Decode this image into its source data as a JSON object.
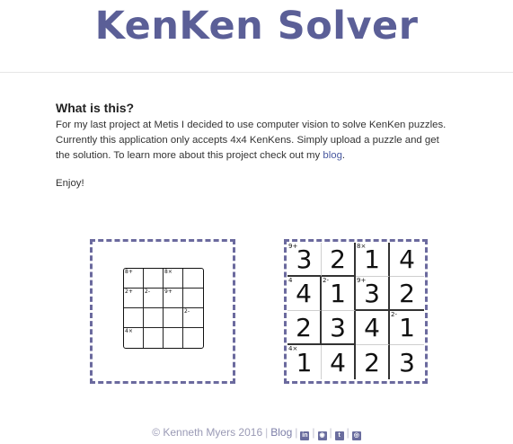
{
  "header": {
    "title": "KenKen Solver"
  },
  "intro": {
    "heading": "What is this?",
    "line1": "For my last project at Metis I decided to use computer vision to solve KenKen puzzles.",
    "line2": "Currently this application only accepts 4x4 KenKens. Simply upload a puzzle and get",
    "line3_before": "the solution. To learn more about this project check out my ",
    "blog_link": "blog",
    "line3_after": ".",
    "enjoy": "Enjoy!"
  },
  "upload_puzzle": {
    "clues": {
      "0": "8+",
      "2": "8×",
      "4": "2+",
      "5": "2-",
      "6": "9+",
      "11": "2-",
      "12": "4×"
    }
  },
  "solution": {
    "values": [
      "3",
      "2",
      "1",
      "4",
      "4",
      "1",
      "3",
      "2",
      "2",
      "3",
      "4",
      "1",
      "1",
      "4",
      "2",
      "3"
    ],
    "clues": {
      "0": "9+",
      "2": "8×",
      "4": "4",
      "5": "2-",
      "6": "9+",
      "11": "2-",
      "12": "4×"
    }
  },
  "footer": {
    "copyright": "© Kenneth Myers 2016",
    "blog": "Blog",
    "icons": [
      "linkedin-icon",
      "github-icon",
      "twitter-icon",
      "instagram-icon"
    ]
  },
  "colors": {
    "accent": "#5b5f97",
    "border": "#6b6a9e"
  }
}
